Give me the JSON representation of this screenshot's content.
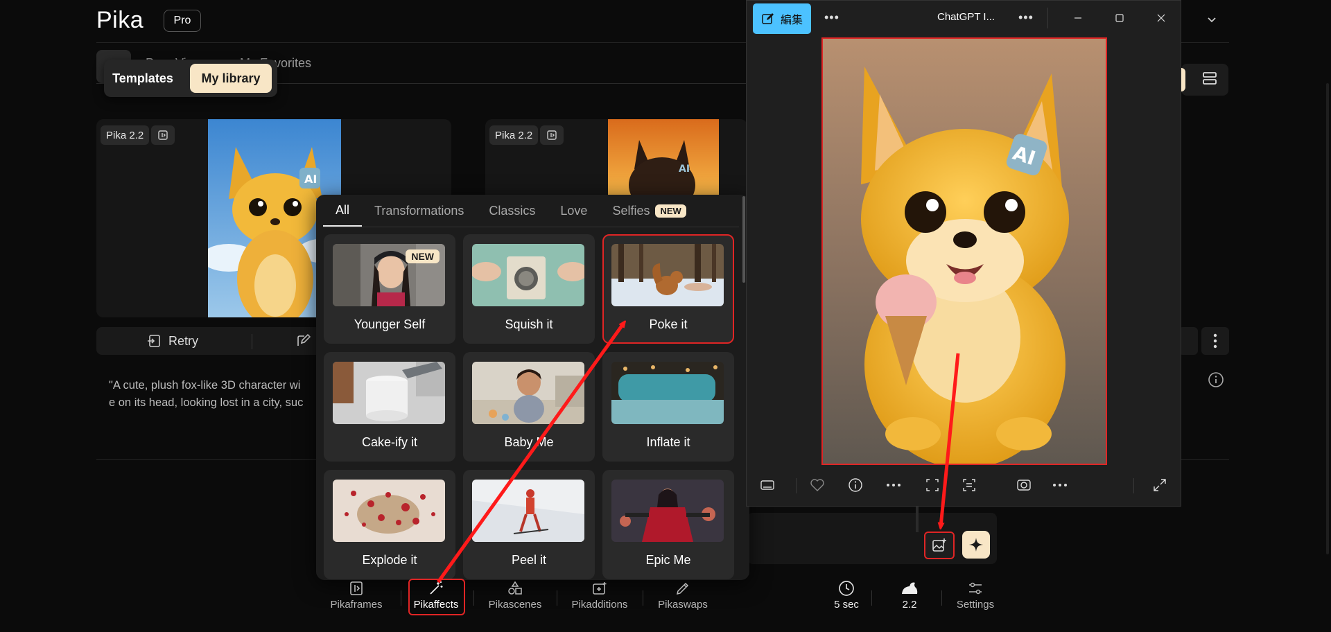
{
  "header": {
    "logo": "Pika",
    "plan_badge": "Pro"
  },
  "subtabs": {
    "faint_left": "Prev·Vi",
    "faint_right": "My Favorites"
  },
  "library_toggle": {
    "templates": "Templates",
    "my_library": "My library"
  },
  "cards": [
    {
      "model": "Pika 2.2"
    },
    {
      "model": "Pika 2.2"
    }
  ],
  "actions": {
    "retry": "Retry"
  },
  "description": "\"A cute, plush fox-like 3D character wi e on its head, looking lost in a city, suc",
  "description_lines": [
    "\"A cute, plush fox-like 3D character wi",
    "e on its head, looking lost in a city, suc"
  ],
  "effects_panel": {
    "tabs": [
      {
        "label": "All",
        "active": true
      },
      {
        "label": "Transformations"
      },
      {
        "label": "Classics"
      },
      {
        "label": "Love"
      },
      {
        "label": "Selfies",
        "badge": "NEW"
      }
    ],
    "tiles": [
      {
        "label": "Younger Self",
        "badge": "NEW"
      },
      {
        "label": "Squish it"
      },
      {
        "label": "Poke it",
        "selected": true
      },
      {
        "label": "Cake-ify it"
      },
      {
        "label": "Baby Me"
      },
      {
        "label": "Inflate it"
      },
      {
        "label": "Explode it"
      },
      {
        "label": "Peel it"
      },
      {
        "label": "Epic Me"
      }
    ]
  },
  "toolbar": {
    "items": [
      {
        "label": "Pikaframes",
        "icon": "frames-icon"
      },
      {
        "label": "Pikaffects",
        "icon": "magic-wand-icon",
        "highlighted": true
      },
      {
        "label": "Pikascenes",
        "icon": "shapes-icon"
      },
      {
        "label": "Pikadditions",
        "icon": "add-image-icon"
      },
      {
        "label": "Pikaswaps",
        "icon": "swap-brush-icon"
      }
    ],
    "duration": {
      "value": "5 sec",
      "icon": "clock-icon"
    },
    "model": {
      "value": "2.2",
      "icon": "rabbit-icon"
    },
    "settings": {
      "label": "Settings",
      "icon": "sliders-icon"
    }
  },
  "photos_window": {
    "edit_label": "編集",
    "title": "ChatGPT I...",
    "photo_badge_text": "AI"
  },
  "colors": {
    "accent_cream": "#f8e6c6",
    "annotation_red": "#e02525",
    "photos_accent": "#4cc2ff",
    "background": "#0b0b0b"
  }
}
